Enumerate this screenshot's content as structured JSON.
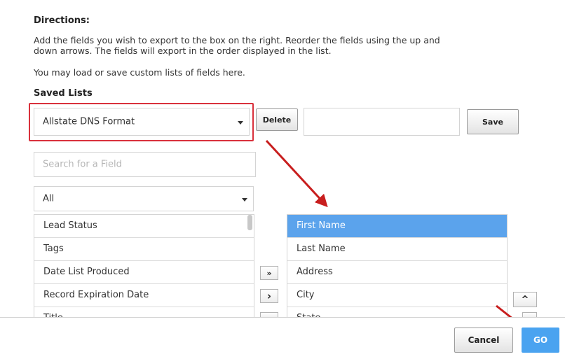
{
  "directions": {
    "heading": "Directions:",
    "line1": "Add the fields you wish to export to the box on the right. Reorder the fields using the up and",
    "line2": "down arrows. The fields will export in the order displayed in the list.",
    "load_text": "You may load or save custom lists of fields here."
  },
  "saved_lists": {
    "heading": "Saved Lists",
    "selected": "Allstate DNS Format",
    "delete_label": "Delete",
    "name_value": "",
    "save_label": "Save"
  },
  "search": {
    "placeholder": "Search for a Field"
  },
  "category_filter": {
    "selected": "All"
  },
  "available_fields": [
    "Lead Status",
    "Tags",
    "Date List Produced",
    "Record Expiration Date",
    "Title"
  ],
  "export_fields": [
    "First Name",
    "Last Name",
    "Address",
    "City",
    "State"
  ],
  "transfer": {
    "add_all_icon": "»",
    "add_icon": "›"
  },
  "reorder": {
    "up_icon": "^"
  },
  "footer": {
    "cancel_label": "Cancel",
    "go_label": "GO"
  },
  "colors": {
    "highlight_border": "#d9313c",
    "arrow": "#c81e1e",
    "selected_row": "#5ba3ec",
    "go_button": "#4aa3f0"
  }
}
